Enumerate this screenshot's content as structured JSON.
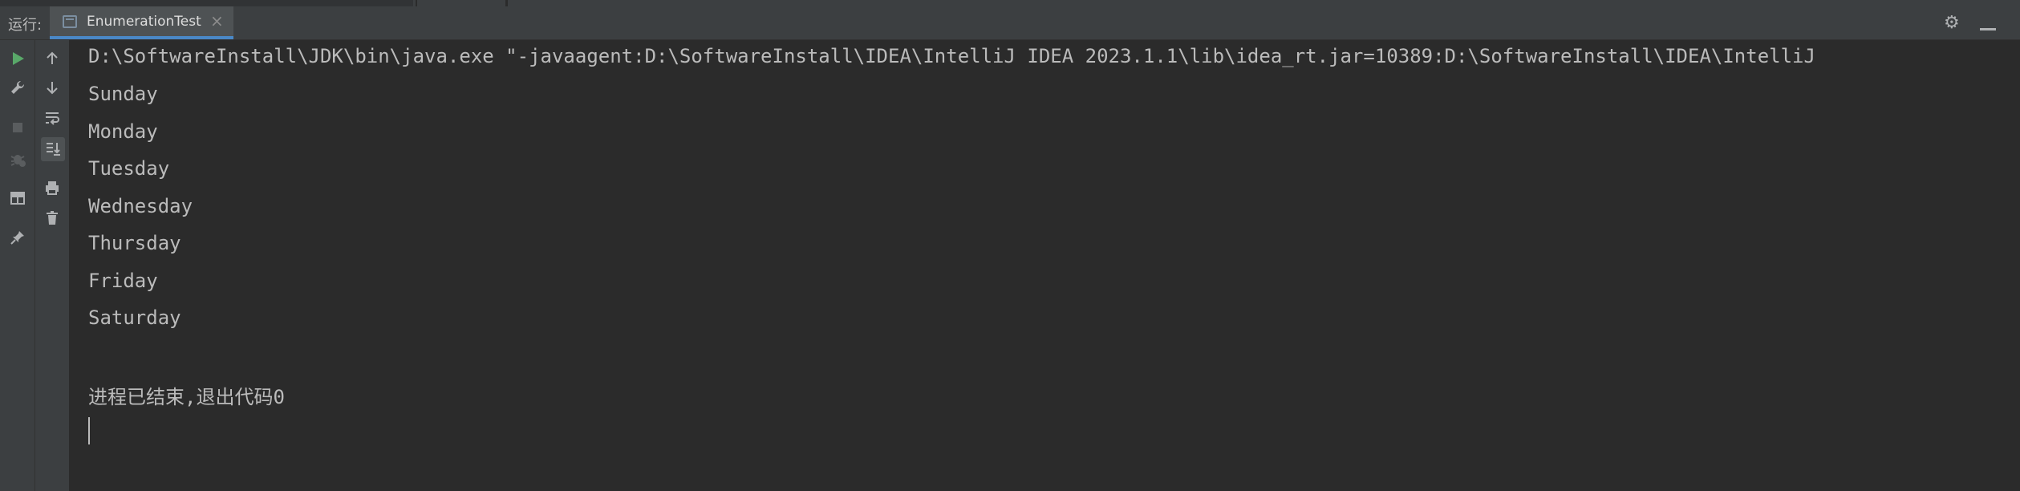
{
  "run_panel": {
    "label": "运行:",
    "tab": {
      "title": "EnumerationTest",
      "close": "×"
    },
    "settings_icon": "⚙"
  },
  "toolbar": {
    "icons": [
      "run-icon",
      "wrench-icon",
      "stop-icon",
      "debug-icon",
      "layout-icon",
      "pin-icon"
    ],
    "secondary_icons": [
      "up-arrow-icon",
      "down-arrow-icon",
      "soft-wrap-icon",
      "scroll-to-end-icon",
      "print-icon",
      "trash-icon"
    ]
  },
  "console": {
    "command": "D:\\SoftwareInstall\\JDK\\bin\\java.exe \"-javaagent:D:\\SoftwareInstall\\IDEA\\IntelliJ IDEA 2023.1.1\\lib\\idea_rt.jar=10389:D:\\SoftwareInstall\\IDEA\\IntelliJ",
    "output": [
      "Sunday",
      "Monday",
      "Tuesday",
      "Wednesday",
      "Thursday",
      "Friday",
      "Saturday"
    ],
    "exit_message": "进程已结束,退出代码0"
  },
  "colors": {
    "background": "#2b2b2b",
    "panel": "#3c3f41",
    "text": "#bbbbbb",
    "accent": "#4a88c7",
    "run_green": "#59a869"
  }
}
